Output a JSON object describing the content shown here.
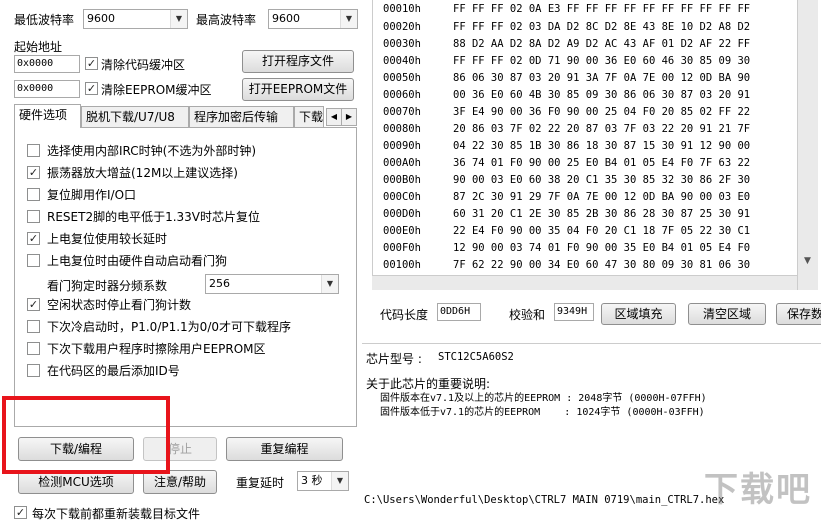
{
  "baud": {
    "min_label": "最低波特率",
    "min_value": "9600",
    "max_label": "最高波特率",
    "max_value": "9600"
  },
  "address": {
    "label": "起始地址",
    "code_addr": "0x0000",
    "eeprom_addr": "0x0000",
    "clear_code_label": "清除代码缓冲区",
    "clear_eeprom_label": "清除EEPROM缓冲区"
  },
  "buttons": {
    "open_program": "打开程序文件",
    "open_eeprom": "打开EEPROM文件",
    "download": "下载/编程",
    "stop": "停止",
    "reprogram": "重复编程",
    "detect_mcu": "检测MCU选项",
    "notice_help": "注意/帮助",
    "fill_area": "区域填充",
    "clear_area": "清空区域",
    "save_data": "保存数"
  },
  "tabs": [
    {
      "label": "硬件选项"
    },
    {
      "label": "脱机下载/U7/U8"
    },
    {
      "label": "程序加密后传输"
    },
    {
      "label": "下载"
    }
  ],
  "options": [
    {
      "label": "选择使用内部IRC时钟(不选为外部时钟)",
      "checked": false
    },
    {
      "label": "振荡器放大增益(12M以上建议选择)",
      "checked": true
    },
    {
      "label": "复位脚用作I/O口",
      "checked": false
    },
    {
      "label": "RESET2脚的电平低于1.33V时芯片复位",
      "checked": false
    },
    {
      "label": "上电复位使用较长延时",
      "checked": true
    },
    {
      "label": "上电复位时由硬件自动启动看门狗",
      "checked": false
    },
    {
      "label": "空闲状态时停止看门狗计数",
      "checked": true
    },
    {
      "label": "下次冷启动时，P1.0/P1.1为0/0才可下载程序",
      "checked": false
    },
    {
      "label": "下次下载用户程序时擦除用户EEPROM区",
      "checked": false
    },
    {
      "label": "在代码区的最后添加ID号",
      "checked": false
    }
  ],
  "watchdog": {
    "label": "看门狗定时器分频系数",
    "value": "256"
  },
  "repeat": {
    "label": "重复延时",
    "value": "3 秒"
  },
  "reload_label": "每次下载前都重新装载目标文件",
  "hex": {
    "rows": [
      {
        "addr": "00010h",
        "bytes": "FF FF FF 02 0A E3 FF FF FF FF FF FF FF FF FF FF"
      },
      {
        "addr": "00020h",
        "bytes": "FF FF FF 02 03 DA D2 8C D2 8E 43 8E 10 D2 A8 D2"
      },
      {
        "addr": "00030h",
        "bytes": "88 D2 AA D2 8A D2 A9 D2 AC 43 AF 01 D2 AF 22 FF"
      },
      {
        "addr": "00040h",
        "bytes": "FF FF FF 02 0D 71 90 00 36 E0 60 46 30 85 09 30"
      },
      {
        "addr": "00050h",
        "bytes": "86 06 30 87 03 20 91 3A 7F 0A 7E 00 12 0D BA 90"
      },
      {
        "addr": "00060h",
        "bytes": "00 36 E0 60 4B 30 85 09 30 86 06 30 87 03 20 91"
      },
      {
        "addr": "00070h",
        "bytes": "3F E4 90 00 36 F0 90 00 25 04 F0 20 85 02 FF 22"
      },
      {
        "addr": "00080h",
        "bytes": "20 86 03 7F 02 22 20 87 03 7F 03 22 20 91 21 7F"
      },
      {
        "addr": "00090h",
        "bytes": "04 22 30 85 1B 30 86 18 30 87 15 30 91 12 90 00"
      },
      {
        "addr": "000A0h",
        "bytes": "36 74 01 F0 90 00 25 E0 B4 01 05 E4 F0 7F 63 22"
      },
      {
        "addr": "000B0h",
        "bytes": "90 00 03 E0 60 38 20 C1 35 30 85 32 30 86 2F 30"
      },
      {
        "addr": "000C0h",
        "bytes": "87 2C 30 91 29 7F 0A 7E 00 12 0D BA 90 00 03 E0"
      },
      {
        "addr": "000D0h",
        "bytes": "60 31 20 C1 2E 30 85 2B 30 86 28 30 87 25 30 91"
      },
      {
        "addr": "000E0h",
        "bytes": "22 E4 F0 90 00 35 04 F0 20 C1 18 7F 05 22 30 C1"
      },
      {
        "addr": "000F0h",
        "bytes": "12 90 00 03 74 01 F0 90 00 35 E0 B4 01 05 E4 F0"
      },
      {
        "addr": "00100h",
        "bytes": "7F 62 22 90 00 34 E0 60 47 30 80 09 30 81 06 30"
      }
    ]
  },
  "status": {
    "code_len_label": "代码长度",
    "code_len_value": "0DD6H",
    "checksum_label": "校验和",
    "checksum_value": "9349H"
  },
  "chip": {
    "model_label": "芯片型号 :",
    "model_value": "STC12C5A60S2",
    "note_title": "关于此芯片的重要说明:",
    "note_line1": "固件版本在v7.1及以上的芯片的EEPROM : 2048字节 (0000H-07FFH)",
    "note_line2": "固件版本低于v7.1的芯片的EEPROM    : 1024字节 (0000H-03FFH)"
  },
  "file_path": "C:\\Users\\Wonderful\\Desktop\\CTRL7 MAIN 0719\\main_CTRL7.hex",
  "watermark": "下载吧",
  "colors": {
    "highlight_red": "#e8141b",
    "window_bg": "#ffffff",
    "button_face": "#e6e6e6"
  }
}
